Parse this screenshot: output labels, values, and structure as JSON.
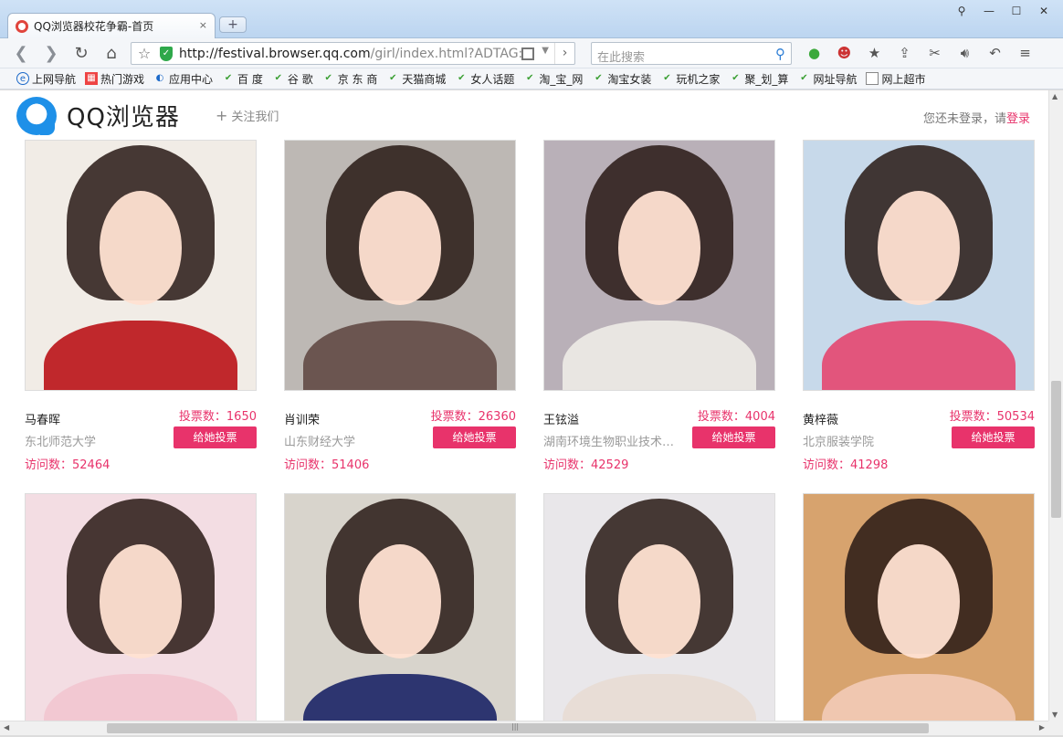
{
  "browser": {
    "tab_title": "QQ浏览器校花争霸-首页",
    "tab_close": "×",
    "new_tab": "+",
    "window_controls": [
      "⚲",
      "—",
      "☐",
      "✕"
    ],
    "url_host": "http://festival.browser.qq.com",
    "url_path": "/girl/index.html?ADTAG:",
    "search_placeholder": "在此搜索",
    "bookmarks": [
      {
        "label": "上网导航",
        "icon": "ie-icon"
      },
      {
        "label": "热门游戏",
        "icon": "game-icon"
      },
      {
        "label": "应用中心",
        "icon": "app-icon"
      },
      {
        "label": "百 度",
        "icon": "hao-icon"
      },
      {
        "label": "谷 歌",
        "icon": "hao-icon"
      },
      {
        "label": "京 东 商",
        "icon": "hao-icon"
      },
      {
        "label": "天猫商城",
        "icon": "hao-icon"
      },
      {
        "label": "女人话题",
        "icon": "hao-icon"
      },
      {
        "label": "淘_宝_网",
        "icon": "hao-icon"
      },
      {
        "label": "淘宝女装",
        "icon": "hao-icon"
      },
      {
        "label": "玩机之家",
        "icon": "hao-icon"
      },
      {
        "label": "聚_划_算",
        "icon": "hao-icon"
      },
      {
        "label": "网址导航",
        "icon": "hao-icon"
      },
      {
        "label": "网上超市",
        "icon": "doc-icon"
      }
    ]
  },
  "site": {
    "logo_text": "QQ浏览器",
    "follow_label": "关注我们",
    "login_prompt": "您还未登录，请",
    "login_link": "登录"
  },
  "cards": [
    {
      "name": "马春晖",
      "votes": "投票数：1650",
      "school": "东北师范大学",
      "button": "给她投票",
      "visits": "访问数：52464",
      "bg": "#f1ece6",
      "body": "#c0282c"
    },
    {
      "name": "肖训荣",
      "votes": "投票数：26360",
      "school": "山东财经大学",
      "button": "给她投票",
      "visits": "访问数：51406",
      "bg": "#bdb8b4",
      "body": "#6b5550"
    },
    {
      "name": "王铉溢",
      "votes": "投票数：4004",
      "school": "湖南环境生物职业技术学院",
      "button": "给她投票",
      "visits": "访问数：42529",
      "bg": "#b9b0b8",
      "body": "#e9e6e2"
    },
    {
      "name": "黄梓薇",
      "votes": "投票数：50534",
      "school": "北京服装学院",
      "button": "给她投票",
      "visits": "访问数：41298",
      "bg": "#c7d9ea",
      "body": "#e2557c"
    },
    {
      "name": "",
      "votes": "",
      "school": "",
      "button": "",
      "visits": "",
      "bg": "#f3dde3",
      "body": "#f2c8d2"
    },
    {
      "name": "",
      "votes": "",
      "school": "",
      "button": "",
      "visits": "",
      "bg": "#d8d4cc",
      "body": "#2d3570"
    },
    {
      "name": "",
      "votes": "",
      "school": "",
      "button": "",
      "visits": "",
      "bg": "#e9e7ea",
      "body": "#e8ddd6"
    },
    {
      "name": "",
      "votes": "",
      "school": "",
      "button": "",
      "visits": "",
      "bg": "#d7a36e",
      "body": "#f0c7b0"
    }
  ]
}
